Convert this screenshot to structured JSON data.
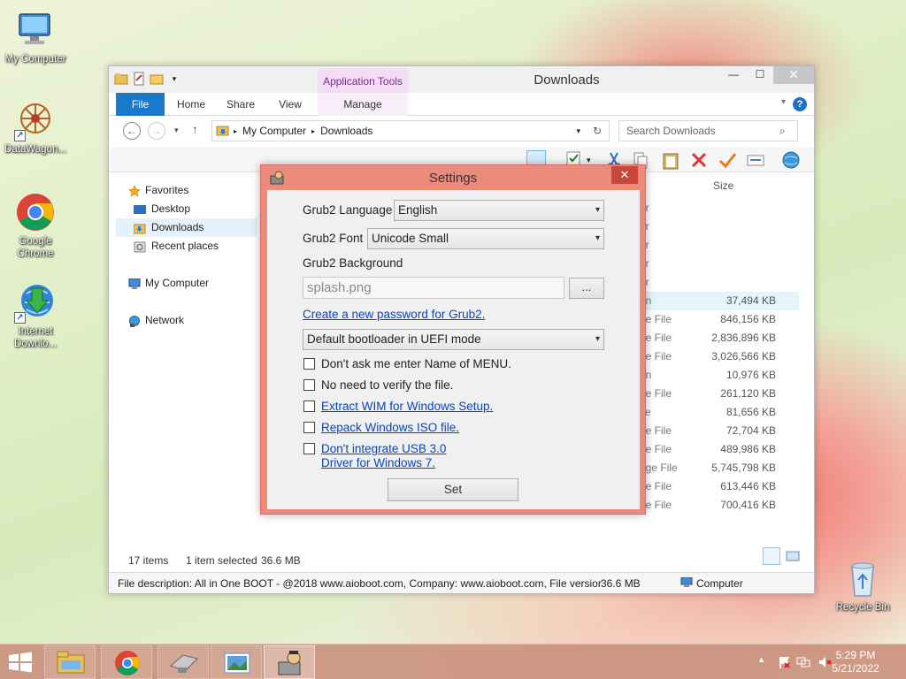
{
  "desktop": {
    "icons": [
      {
        "label": "My Computer"
      },
      {
        "label": "DataWagon..."
      },
      {
        "label": "Google Chrome"
      },
      {
        "label": "Internet Downlo..."
      },
      {
        "label": "Recycle Bin"
      }
    ]
  },
  "explorer": {
    "contextual_tab": "Application Tools",
    "title": "Downloads",
    "tabs": [
      "File",
      "Home",
      "Share",
      "View",
      "Manage"
    ],
    "address": [
      "My Computer",
      "Downloads"
    ],
    "search_placeholder": "Search Downloads",
    "column_size": "Size",
    "nav": {
      "favorites": "Favorites",
      "desktop": "Desktop",
      "downloads": "Downloads",
      "recent": "Recent places",
      "my_computer": "My Computer",
      "network": "Network"
    },
    "files": [
      {
        "type": "er",
        "size": ""
      },
      {
        "type": "er",
        "size": ""
      },
      {
        "type": "er",
        "size": ""
      },
      {
        "type": "er",
        "size": ""
      },
      {
        "type": "er",
        "size": ""
      },
      {
        "type": "on",
        "size": "37,494 KB"
      },
      {
        "type": "ge File",
        "size": "846,156 KB"
      },
      {
        "type": "ge File",
        "size": "2,836,896 KB"
      },
      {
        "type": "ge File",
        "size": "3,026,566 KB"
      },
      {
        "type": "on",
        "size": "10,976 KB"
      },
      {
        "type": "ge File",
        "size": "261,120 KB"
      },
      {
        "type": "ve",
        "size": "81,656 KB"
      },
      {
        "type": "ge File",
        "size": "72,704 KB"
      },
      {
        "type": "ge File",
        "size": "489,986 KB"
      },
      {
        "type": "age File",
        "size": "5,745,798 KB"
      },
      {
        "type": "ge File",
        "size": "613,446 KB"
      },
      {
        "type": "ge File",
        "size": "700,416 KB"
      }
    ],
    "status": {
      "items": "17 items",
      "selected": "1 item selected",
      "selected_size": "36.6 MB"
    },
    "infobar": {
      "description": "File description: All in One BOOT - @2018 www.aioboot.com, Company: www.aioboot.com, File versior",
      "size": "36.6 MB",
      "location": "Computer"
    }
  },
  "settings": {
    "title": "Settings",
    "close": "✕",
    "language_label": "Grub2 Language",
    "language_value": "English",
    "font_label": "Grub2 Font",
    "font_value": "Unicode Small",
    "background_label": "Grub2 Background",
    "background_value": "splash.png",
    "browse_label": "...",
    "password_link": "Create a new password for Grub2.",
    "bootloader_value": "Default bootloader in UEFI mode",
    "checks": [
      {
        "label": "Don't ask me enter Name of MENU.",
        "link": false
      },
      {
        "label": "No need to verify the file.",
        "link": false
      },
      {
        "label": "Extract WIM for Windows Setup.",
        "link": true
      },
      {
        "label": "Repack Windows ISO file.",
        "link": true
      }
    ],
    "usb_line1": "Don't integrate USB 3.0",
    "usb_line2": "Driver for Windows 7.",
    "set_label": "Set"
  },
  "taskbar": {
    "time": "5:29 PM",
    "date": "5/21/2022"
  },
  "colors": {
    "accent": "#1979ca",
    "dialog_border": "#ec8a7c",
    "link": "#0645c6"
  }
}
